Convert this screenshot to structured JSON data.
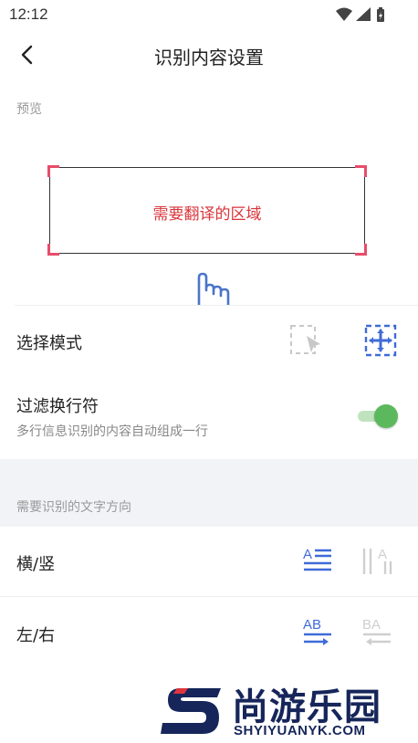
{
  "status_bar": {
    "time": "12:12"
  },
  "header": {
    "title": "识别内容设置"
  },
  "preview": {
    "label": "预览",
    "area_text": "需要翻译的区域"
  },
  "mode": {
    "title": "选择模式"
  },
  "filter": {
    "title": "过滤换行符",
    "subtitle": "多行信息识别的内容自动组成一行",
    "enabled": true
  },
  "direction": {
    "section_label": "需要识别的文字方向",
    "hv_title": "横/竖",
    "lr_title": "左/右",
    "lr_active_icon_text": "AB",
    "lr_inactive_icon_text": "BA"
  },
  "watermark": {
    "name": "尚游乐园",
    "url": "SHYIYUANYK.COM"
  },
  "colors": {
    "accent_blue": "#3f6bd8",
    "toggle_green": "#5cb85c",
    "preview_red": "#d9343a",
    "corner_pink": "#e84c6a"
  }
}
